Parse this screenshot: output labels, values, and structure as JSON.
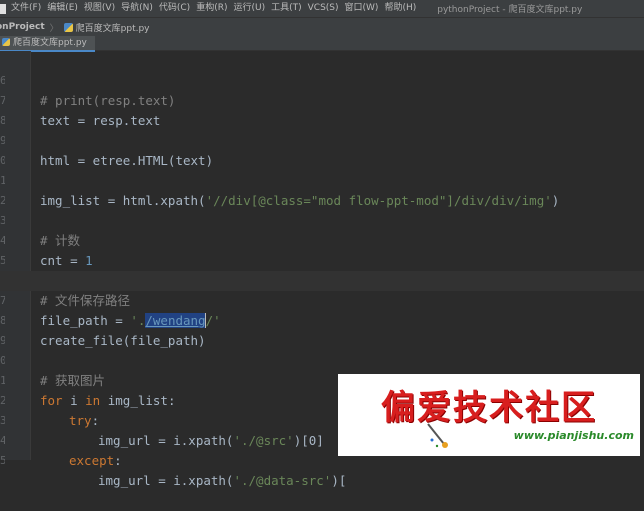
{
  "menubar": {
    "items": [
      "文件(F)",
      "编辑(E)",
      "视图(V)",
      "导航(N)",
      "代码(C)",
      "重构(R)",
      "运行(U)",
      "工具(T)",
      "VCS(S)",
      "窗口(W)",
      "帮助(H)"
    ],
    "window_title": "pythonProject - 爬百度文库ppt.py"
  },
  "navbar": {
    "project": "onProject",
    "file": "爬百度文库ppt.py"
  },
  "tab": {
    "label": "爬百度文库ppt.py"
  },
  "editor": {
    "line_numbers": [
      "6",
      "7",
      "8",
      "9",
      "0",
      "1",
      "2",
      "3",
      "4",
      "5",
      "6",
      "7",
      "8",
      "9",
      "0",
      "1",
      "2",
      "3",
      "4",
      "5"
    ],
    "code": {
      "l1": "# print(resp.text)",
      "l2": "text = resp.text",
      "l3": "html = etree.HTML(text)",
      "l4_a": "img_list = html.xpath(",
      "l4_b": "'//div[@class=\"mod flow-ppt-mod\"]/div/div/img'",
      "l4_c": ")",
      "l5": "# 计数",
      "l6_a": "cnt = ",
      "l6_b": "1",
      "l7": "# 文件保存路径",
      "l8_a": "file_path = ",
      "l8_b": "'.",
      "l8_sel": "/wendang",
      "l8_c": "/'",
      "l9": "create_file(file_path)",
      "l10": "# 获取图片",
      "l11_kw1": "for",
      "l11_a": " i ",
      "l11_kw2": "in",
      "l11_b": " img_list:",
      "l12_kw": "try",
      "l12_a": ":",
      "l13_a": "img_url = i.xpath(",
      "l13_b": "'./@src'",
      "l13_c": ")[0]",
      "l14_kw": "except",
      "l14_a": ":",
      "l15_a": "img_url = i.xpath(",
      "l15_b": "'./@data-src'",
      "l15_c": ")["
    }
  },
  "watermark": {
    "title": "偏爱技术社区",
    "url": "www.pianjishu.com"
  },
  "colors": {
    "background": "#2b2b2b",
    "comment": "#808080",
    "string": "#6a8759",
    "keyword": "#cc7832",
    "number": "#6897bb",
    "identifier": "#a9b7c6",
    "watermark_red": "#d81e1e",
    "watermark_green": "#2a8a2a"
  }
}
